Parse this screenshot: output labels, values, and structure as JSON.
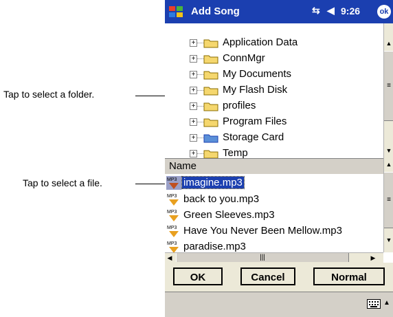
{
  "callouts": {
    "folder": "Tap to select a folder.",
    "file": "Tap to select a file."
  },
  "titlebar": {
    "title": "Add Song",
    "time": "9:26",
    "ok_label": "ok"
  },
  "tree": {
    "items": [
      {
        "label": "Application Data"
      },
      {
        "label": "ConnMgr"
      },
      {
        "label": "My Documents"
      },
      {
        "label": "My Flash Disk"
      },
      {
        "label": "profiles"
      },
      {
        "label": "Program Files"
      },
      {
        "label": "Storage Card"
      },
      {
        "label": "Temp"
      }
    ]
  },
  "file_list": {
    "column_header": "Name",
    "files": [
      {
        "name": "imagine.mp3",
        "selected": true
      },
      {
        "name": "back to you.mp3"
      },
      {
        "name": "Green Sleeves.mp3"
      },
      {
        "name": "Have You Never Been Mellow.mp3"
      },
      {
        "name": "paradise.mp3"
      }
    ],
    "icon_label": "MP3"
  },
  "buttons": {
    "ok": "OK",
    "cancel": "Cancel",
    "normal": "Normal"
  },
  "colors": {
    "titlebar": "#1b3fb0",
    "selection": "#1b3fb0",
    "folder": "#f5d76e",
    "storage_card": "#5a8fd8"
  }
}
